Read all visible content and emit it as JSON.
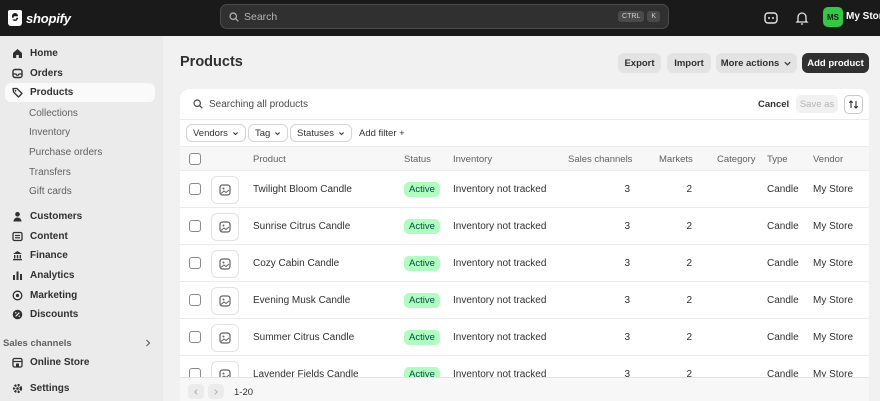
{
  "topbar": {
    "brand": "shopify",
    "search_placeholder": "Search",
    "shortcut_keys": [
      "CTRL",
      "K"
    ],
    "avatar_initials": "MS",
    "store_name": "My Store"
  },
  "sidebar": {
    "items": [
      {
        "label": "Home",
        "icon": "home-icon"
      },
      {
        "label": "Orders",
        "icon": "inbox-icon"
      },
      {
        "label": "Products",
        "icon": "tag-icon",
        "active": true
      }
    ],
    "product_subitems": [
      "Collections",
      "Inventory",
      "Purchase orders",
      "Transfers",
      "Gift cards"
    ],
    "items2": [
      {
        "label": "Customers",
        "icon": "person-icon"
      },
      {
        "label": "Content",
        "icon": "content-icon"
      },
      {
        "label": "Finance",
        "icon": "bank-icon"
      },
      {
        "label": "Analytics",
        "icon": "bar-chart-icon"
      },
      {
        "label": "Marketing",
        "icon": "target-icon"
      },
      {
        "label": "Discounts",
        "icon": "discount-icon"
      }
    ],
    "sales_channels_label": "Sales channels",
    "online_store_label": "Online Store",
    "settings_label": "Settings"
  },
  "page": {
    "title": "Products",
    "buttons": {
      "export": "Export",
      "import": "Import",
      "more_actions": "More actions",
      "add_product": "Add product"
    }
  },
  "search_bar": {
    "text": "Searching all products",
    "cancel": "Cancel",
    "save_as": "Save as"
  },
  "filters": [
    "Vendors",
    "Tag",
    "Statuses",
    "Add filter +"
  ],
  "table": {
    "headers": {
      "product": "Product",
      "status": "Status",
      "inventory": "Inventory",
      "sales_channels": "Sales channels",
      "markets": "Markets",
      "category": "Category",
      "type": "Type",
      "vendor": "Vendor"
    },
    "rows": [
      {
        "product": "Twilight Bloom Candle",
        "status": "Active",
        "inventory": "Inventory not tracked",
        "sales_channels": "3",
        "markets": "2",
        "category": "",
        "type": "Candle",
        "vendor": "My Store"
      },
      {
        "product": "Sunrise Citrus Candle",
        "status": "Active",
        "inventory": "Inventory not tracked",
        "sales_channels": "3",
        "markets": "2",
        "category": "",
        "type": "Candle",
        "vendor": "My Store"
      },
      {
        "product": "Cozy Cabin Candle",
        "status": "Active",
        "inventory": "Inventory not tracked",
        "sales_channels": "3",
        "markets": "2",
        "category": "",
        "type": "Candle",
        "vendor": "My Store"
      },
      {
        "product": "Evening Musk Candle",
        "status": "Active",
        "inventory": "Inventory not tracked",
        "sales_channels": "3",
        "markets": "2",
        "category": "",
        "type": "Candle",
        "vendor": "My Store"
      },
      {
        "product": "Summer Citrus Candle",
        "status": "Active",
        "inventory": "Inventory not tracked",
        "sales_channels": "3",
        "markets": "2",
        "category": "",
        "type": "Candle",
        "vendor": "My Store"
      },
      {
        "product": "Lavender Fields Candle",
        "status": "Active",
        "inventory": "Inventory not tracked",
        "sales_channels": "3",
        "markets": "2",
        "category": "",
        "type": "Candle",
        "vendor": "My Store"
      }
    ]
  },
  "pagination": {
    "range": "1-20"
  },
  "colors": {
    "active_badge_bg": "#affebf",
    "active_badge_text": "#014b40",
    "avatar_bg": "#2ecc40",
    "topbar_bg": "#1a1a1a"
  }
}
